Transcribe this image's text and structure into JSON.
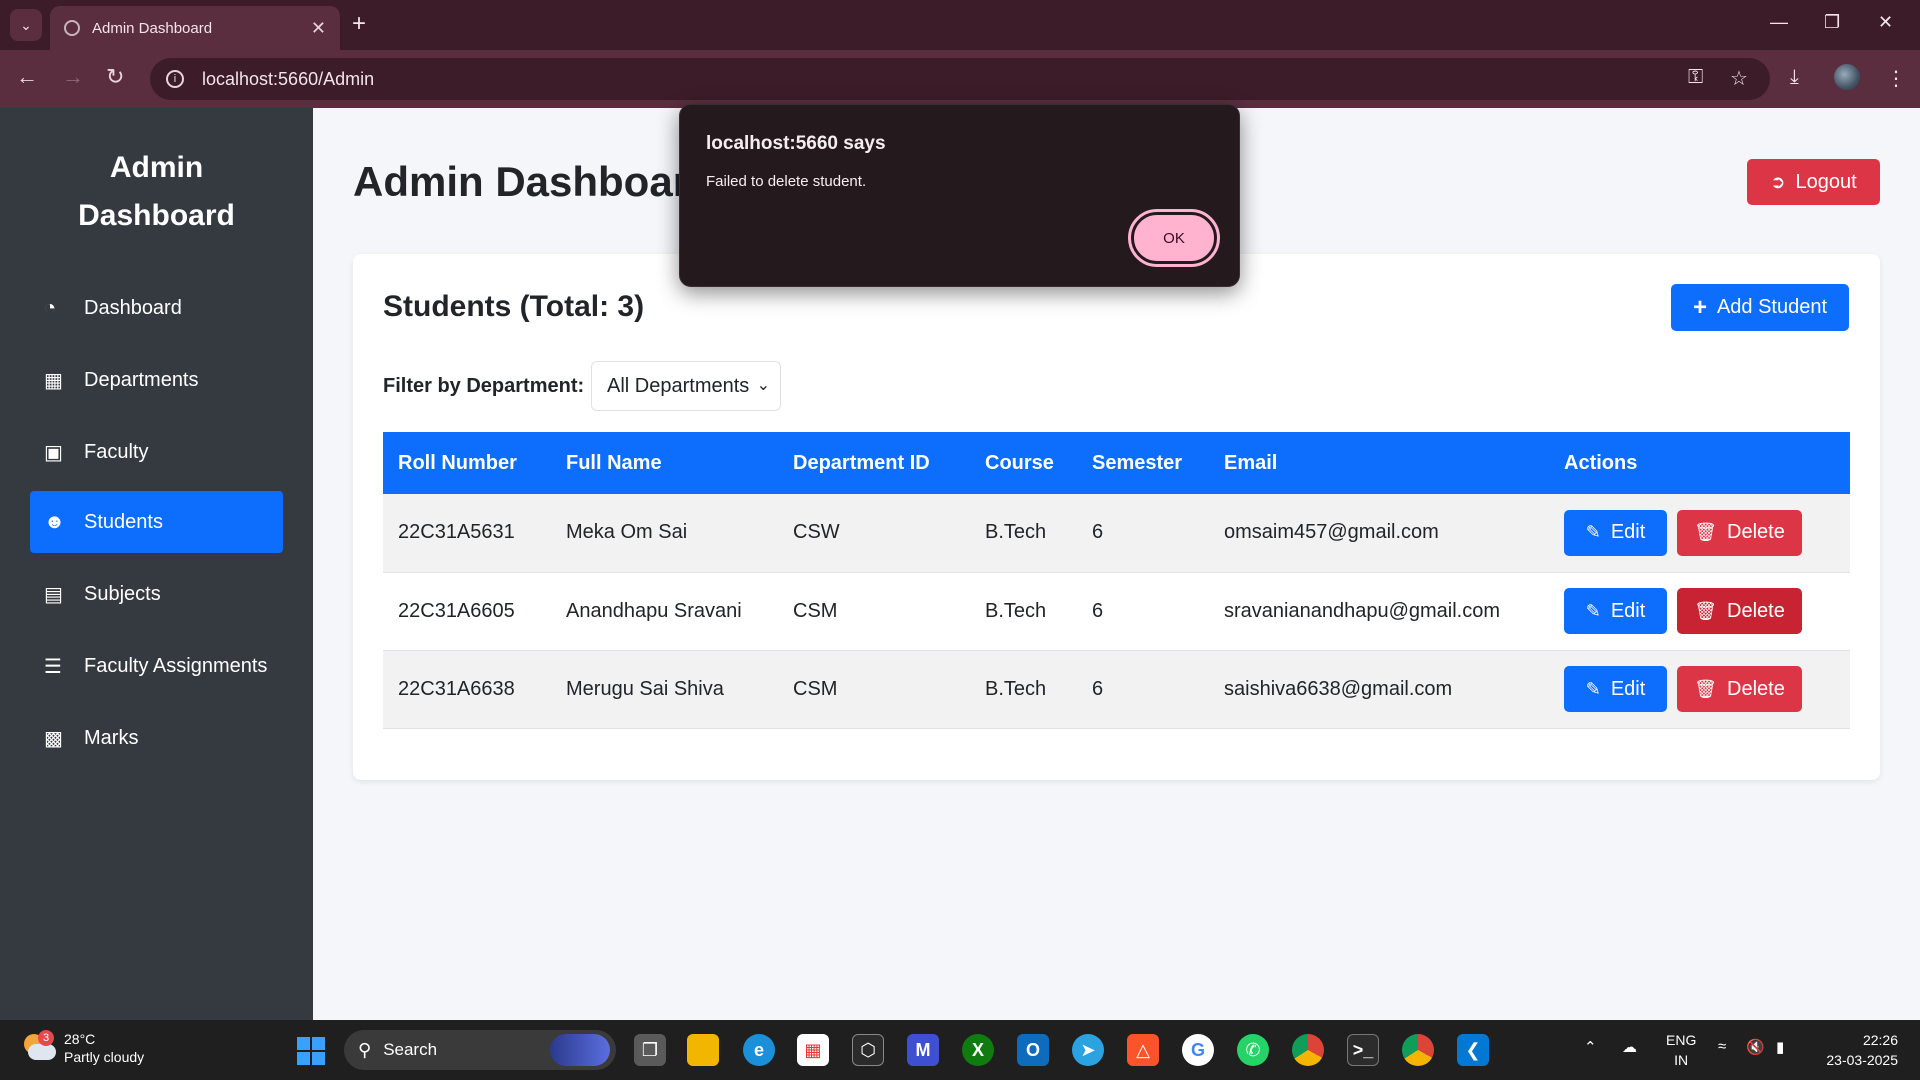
{
  "browser": {
    "tab_title": "Admin Dashboard",
    "url": "localhost:5660/Admin"
  },
  "sidebar": {
    "brand_line1": "Admin",
    "brand_line2": "Dashboard",
    "items": [
      {
        "label": "Dashboard",
        "icon": "tachometer-icon"
      },
      {
        "label": "Departments",
        "icon": "building-icon"
      },
      {
        "label": "Faculty",
        "icon": "chalkboard-teacher-icon"
      },
      {
        "label": "Students",
        "icon": "users-icon",
        "active": true
      },
      {
        "label": "Subjects",
        "icon": "book-icon"
      },
      {
        "label": "Faculty Assignments",
        "icon": "list-check-icon"
      },
      {
        "label": "Marks",
        "icon": "clipboard-icon"
      }
    ]
  },
  "header": {
    "title": "Admin Dashboard",
    "logout_label": "Logout"
  },
  "students": {
    "title": "Students (Total: 3)",
    "add_label": "Add Student",
    "filter_label": "Filter by Department:",
    "filter_value": "All Departments",
    "columns": [
      "Roll Number",
      "Full Name",
      "Department ID",
      "Course",
      "Semester",
      "Email",
      "Actions"
    ],
    "rows": [
      {
        "roll": "22C31A5631",
        "name": "Meka Om Sai",
        "dept": "CSW",
        "course": "B.Tech",
        "semester": "6",
        "email": "omsaim457@gmail.com"
      },
      {
        "roll": "22C31A6605",
        "name": "Anandhapu Sravani",
        "dept": "CSM",
        "course": "B.Tech",
        "semester": "6",
        "email": "sravanianandhapu@gmail.com"
      },
      {
        "roll": "22C31A6638",
        "name": "Merugu Sai Shiva",
        "dept": "CSM",
        "course": "B.Tech",
        "semester": "6",
        "email": "saishiva6638@gmail.com"
      }
    ],
    "edit_label": "Edit",
    "delete_label": "Delete"
  },
  "dialog": {
    "title": "localhost:5660 says",
    "message": "Failed to delete student.",
    "ok_label": "OK"
  },
  "taskbar": {
    "weather_temp": "28°C",
    "weather_desc": "Partly cloudy",
    "weather_badge": "3",
    "search_label": "Search",
    "lang_line1": "ENG",
    "lang_line2": "IN",
    "time": "22:26",
    "date": "23-03-2025"
  },
  "colors": {
    "primary": "#0d6efd",
    "danger": "#dc3545",
    "sidebar_bg": "#343a40",
    "browser_frame": "#3c1c28"
  }
}
